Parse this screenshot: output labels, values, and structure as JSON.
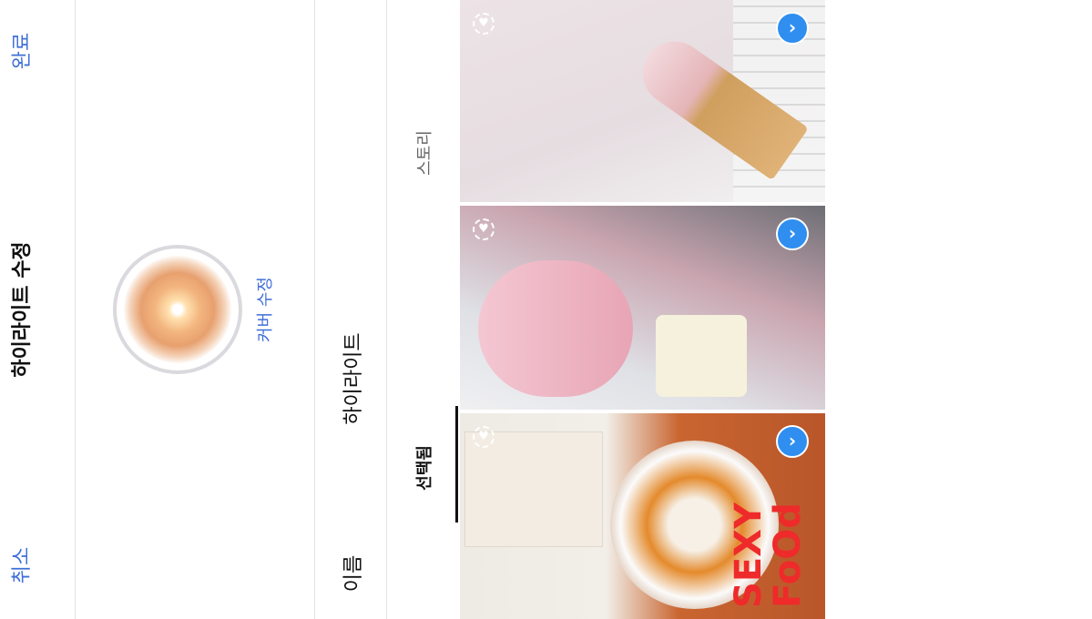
{
  "header": {
    "cancel_label": "취소",
    "title": "하이라이트 수정",
    "done_label": "완료"
  },
  "cover": {
    "edit_label": "커버 수정"
  },
  "name_field": {
    "label": "이름",
    "value": "하이라이트"
  },
  "tabs": [
    {
      "label": "선택됨",
      "selected": true
    },
    {
      "label": "스토리",
      "selected": false
    }
  ],
  "stories": [
    {
      "description": "ice-cream-cone",
      "selected": true,
      "overlay_text": ""
    },
    {
      "description": "dessert-table",
      "selected": true,
      "overlay_text": ""
    },
    {
      "description": "chicken-and-soup",
      "selected": true,
      "overlay_text_line1": "SEXY",
      "overlay_text_line2": "FoOd"
    }
  ],
  "colors": {
    "accent": "#3f6fd8",
    "check": "#2f8ef0",
    "overlay_text": "#ee2a2a"
  }
}
